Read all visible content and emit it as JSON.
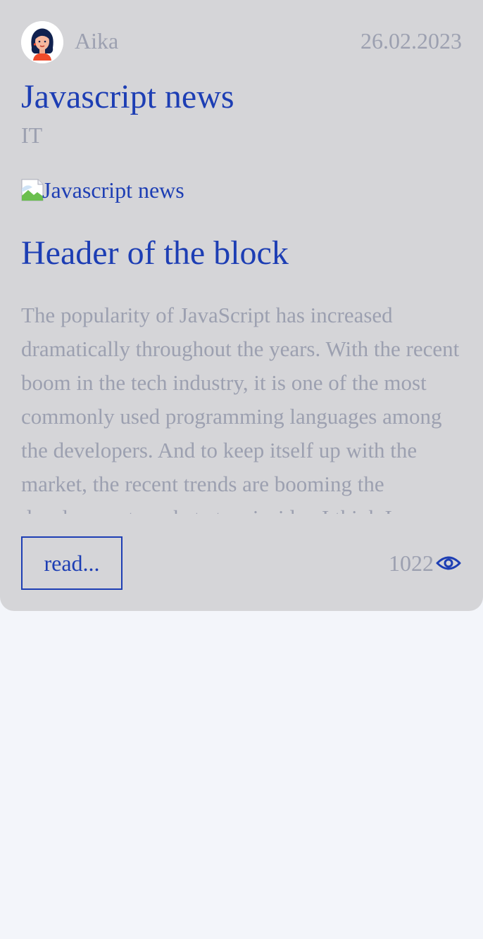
{
  "post": {
    "author": "Aika",
    "date": "26.02.2023",
    "title": "Javascript news",
    "category": "IT",
    "image_alt": "Javascript news",
    "block_header": "Header of the block",
    "body": "The popularity of JavaScript has increased dramatically throughout the years. With the recent boom in the tech industry, it is one of the most commonly used programming languages among the developers. And to keep itself up with the market, the recent trends are booming the development market at an insider. I think I",
    "read_label": "read...",
    "views": "1022"
  },
  "colors": {
    "accent": "#1d3eb4",
    "muted_text": "#9ca0b0",
    "card_background": "#d5d5d8",
    "page_background": "#f3f5fa"
  },
  "icons": {
    "avatar": "woman-avatar-icon",
    "broken_image": "broken-image-icon",
    "views": "eye-icon"
  }
}
